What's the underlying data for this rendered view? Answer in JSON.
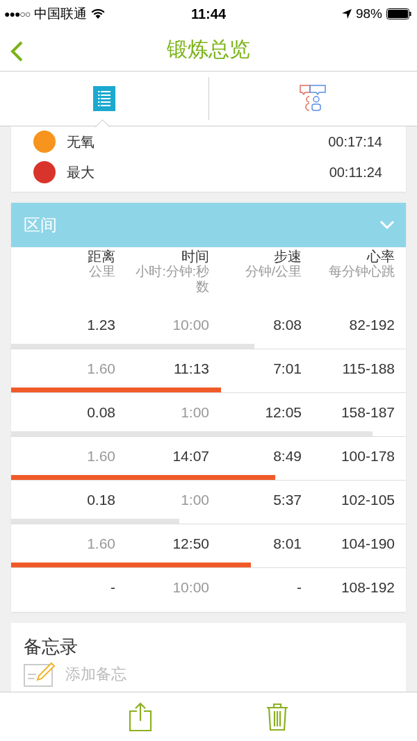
{
  "status_bar": {
    "signal": "●●●○○",
    "carrier": "中国联通",
    "time": "11:44",
    "battery": "98%"
  },
  "nav": {
    "title": "锻炼总览"
  },
  "tabs": [
    {
      "kind": "list",
      "selected": true
    },
    {
      "kind": "people",
      "selected": false
    }
  ],
  "zones": [
    {
      "name": "无氧",
      "time": "00:17:14",
      "color": "#f7941d"
    },
    {
      "name": "最大",
      "time": "00:11:24",
      "color": "#d9342b"
    }
  ],
  "intervals": {
    "title": "区间",
    "expanded": true,
    "columns": [
      {
        "label": "距离",
        "unit": "公里"
      },
      {
        "label": "时间",
        "unit": "小时:分钟:秒数"
      },
      {
        "label": "步速",
        "unit": "分钟/公里"
      },
      {
        "label": "心率",
        "unit": "每分钟心跳"
      }
    ],
    "rows": [
      {
        "kind": "recovery",
        "distance": "1.23",
        "time": "10:00",
        "pace": "8:08",
        "heart_rate": "82-192",
        "level": 0.616
      },
      {
        "kind": "work",
        "distance": "1.60",
        "time": "11:13",
        "pace": "7:01",
        "heart_rate": "115-188",
        "level": 0.532
      },
      {
        "kind": "recovery",
        "distance": "0.08",
        "time": "1:00",
        "pace": "12:05",
        "heart_rate": "158-187",
        "level": 0.915
      },
      {
        "kind": "work",
        "distance": "1.60",
        "time": "14:07",
        "pace": "8:49",
        "heart_rate": "100-178",
        "level": 0.669
      },
      {
        "kind": "recovery",
        "distance": "0.18",
        "time": "1:00",
        "pace": "5:37",
        "heart_rate": "102-105",
        "level": 0.426
      },
      {
        "kind": "work",
        "distance": "1.60",
        "time": "12:50",
        "pace": "8:01",
        "heart_rate": "104-190",
        "level": 0.607
      },
      {
        "kind": "recovery",
        "distance": "-",
        "time": "10:00",
        "pace": "-",
        "heart_rate": "108-192"
      }
    ]
  },
  "memo": {
    "title": "备忘录",
    "placeholder": "添加备忘"
  }
}
